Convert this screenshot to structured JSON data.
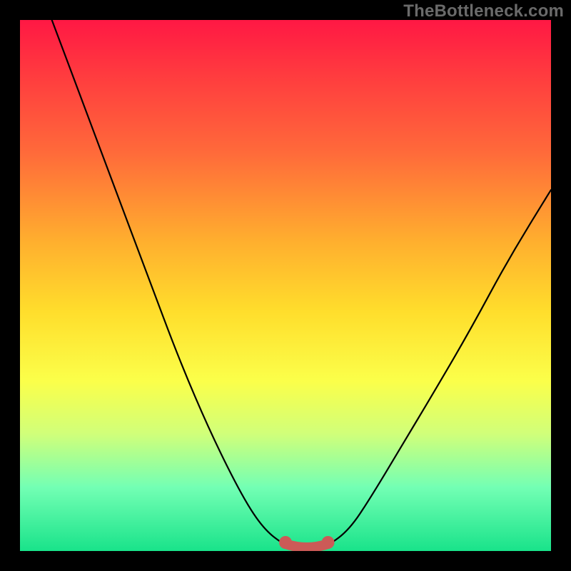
{
  "watermark": "TheBottleneck.com",
  "chart_data": {
    "type": "line",
    "title": "",
    "xlabel": "",
    "ylabel": "",
    "xlim": [
      0,
      100
    ],
    "ylim": [
      0,
      100
    ],
    "series": [
      {
        "name": "bottleneck-curve",
        "x": [
          0,
          6,
          12,
          18,
          24,
          30,
          36,
          42,
          46,
          50,
          52,
          54,
          56,
          58,
          62,
          66,
          72,
          78,
          85,
          92,
          100
        ],
        "y": [
          116,
          100,
          84,
          68,
          52,
          36,
          22,
          10,
          4,
          1,
          0.5,
          0.5,
          0.5,
          1,
          4,
          10,
          20,
          30,
          42,
          55,
          68
        ]
      }
    ],
    "highlight": {
      "name": "optimal-range-marker",
      "x_start": 50,
      "x_end": 58,
      "y": 0.8
    },
    "background_gradient": {
      "top": "#ff1844",
      "bottom": "#19e38a",
      "meaning": "high-to-low-bottleneck"
    }
  }
}
